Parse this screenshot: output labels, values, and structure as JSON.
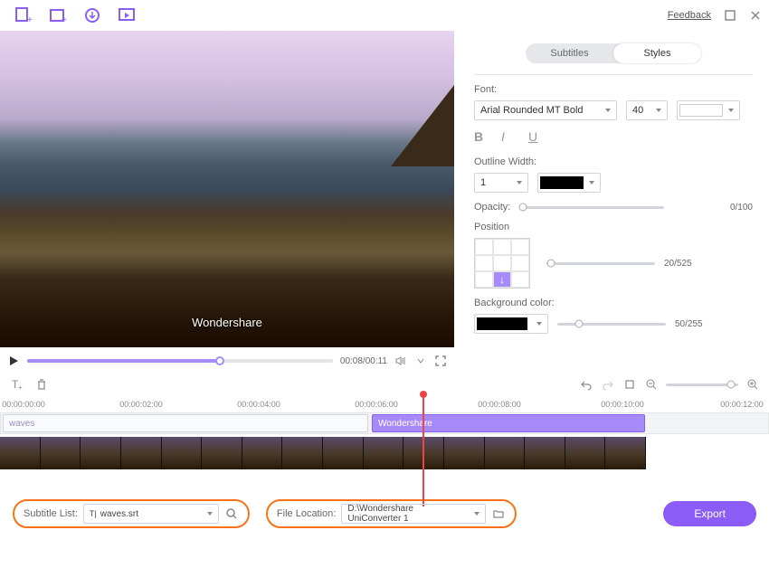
{
  "window": {
    "feedback": "Feedback"
  },
  "preview": {
    "overlay_text": "Wondershare",
    "time": "00:08/00:11"
  },
  "tabs": {
    "subtitles": "Subtitles",
    "styles": "Styles"
  },
  "panel": {
    "font_label": "Font:",
    "font_family": "Arial Rounded MT Bold",
    "font_size": "40",
    "outline_label": "Outline Width:",
    "outline_width": "1",
    "opacity_label": "Opacity:",
    "opacity_value": "0/100",
    "position_label": "Position",
    "position_value": "20/525",
    "bg_label": "Background color:",
    "bg_value": "50/255"
  },
  "timeline": {
    "marks": [
      "00:00:00:00",
      "00:00:02:00",
      "00:00:04:00",
      "00:00:06:00",
      "00:00:08:00",
      "00:00:10:00",
      "00:00:12:00"
    ],
    "clip1": "waves",
    "clip2": "Wondershare"
  },
  "footer": {
    "subtitle_list_label": "Subtitle List:",
    "subtitle_file": "waves.srt",
    "file_location_label": "File Location:",
    "file_location": "D:\\Wondershare UniConverter 1",
    "export": "Export"
  }
}
